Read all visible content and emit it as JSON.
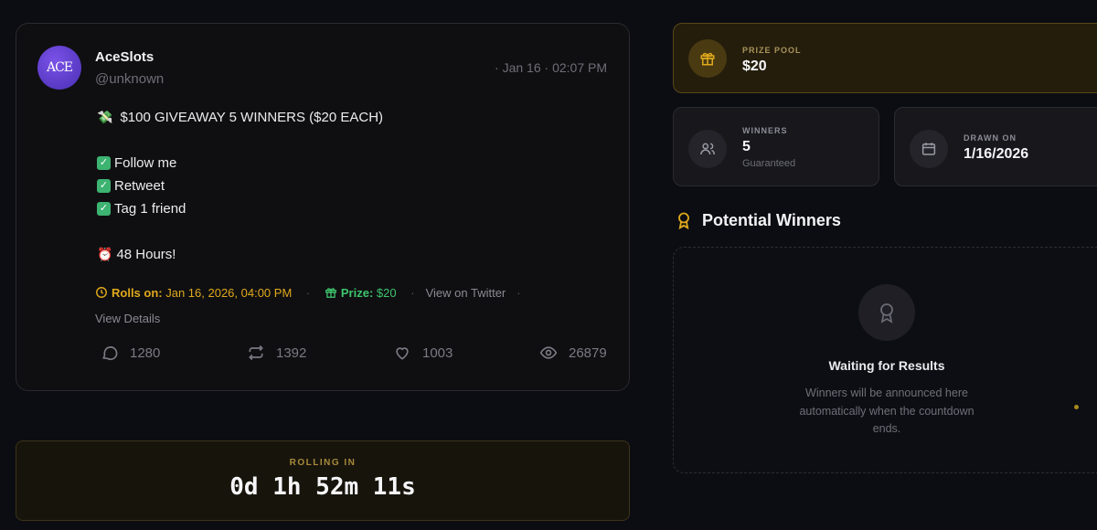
{
  "tweet": {
    "author_name": "AceSlots",
    "author_handle": "@unknown",
    "avatar_text": "ACE",
    "timestamp": "· Jan 16 · 02:07 PM",
    "lines": [
      "$100 GIVEAWAY 5 WINNERS ($20 EACH)",
      "",
      "Follow me",
      "Retweet",
      "Tag 1 friend",
      "",
      "48 Hours!"
    ],
    "rolls_label": "Rolls on:",
    "rolls_value": "Jan 16, 2026, 04:00 PM",
    "prize_label": "Prize:",
    "prize_value": "$20",
    "view_twitter": "View on Twitter",
    "view_details": "View Details",
    "stats": {
      "replies": "1280",
      "retweets": "1392",
      "likes": "1003",
      "views": "26879"
    }
  },
  "countdown": {
    "label": "ROLLING IN",
    "value": "0d 1h 52m 11s"
  },
  "prize_pool": {
    "label": "PRIZE POOL",
    "value": "$20"
  },
  "winners": {
    "label": "WINNERS",
    "value": "5",
    "sub": "Guaranteed"
  },
  "drawn_on": {
    "label": "DRAWN ON",
    "value": "1/16/2026"
  },
  "potential_winners": {
    "title": "Potential Winners",
    "waiting_title": "Waiting for Results",
    "waiting_desc": "Winners will be announced here automatically when the countdown ends."
  },
  "colors": {
    "accent_gold": "#e0a91c",
    "accent_green": "#3ec46d",
    "background": "#0c0d12"
  }
}
